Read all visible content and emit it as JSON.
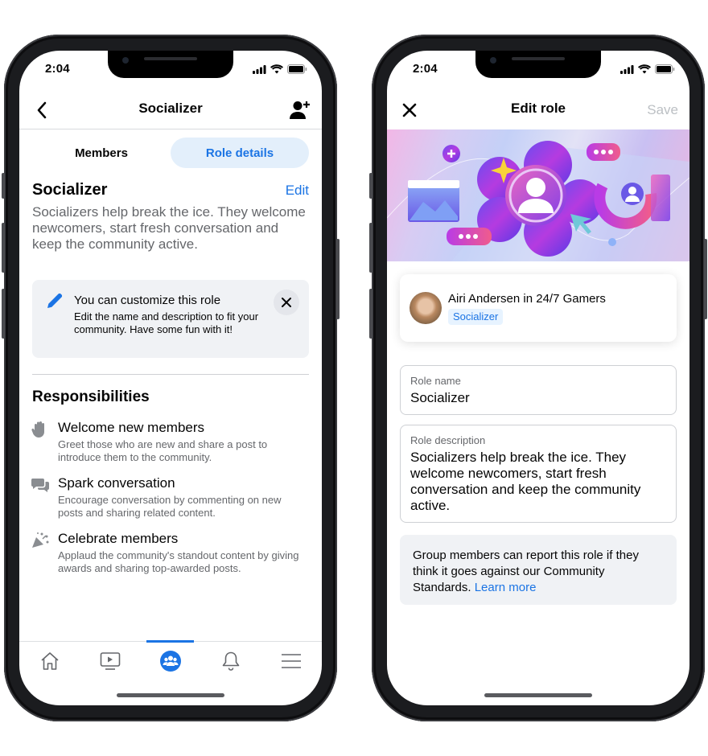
{
  "status_bar": {
    "time": "2:04"
  },
  "left_screen": {
    "nav": {
      "title": "Socializer",
      "back_icon": "chevron-left-icon",
      "action_icon": "add-person-icon"
    },
    "tabs": [
      {
        "label": "Members",
        "active": false
      },
      {
        "label": "Role details",
        "active": true
      }
    ],
    "role": {
      "title": "Socializer",
      "edit_label": "Edit",
      "description": "Socializers help break the ice. They welcome newcomers, start fresh conversation and keep the community active."
    },
    "tip": {
      "icon": "pencil-icon",
      "title": "You can customize this role",
      "body": "Edit the name and description to fit your community. Have some fun with it!",
      "close_icon": "close-icon"
    },
    "responsibilities": {
      "title": "Responsibilities",
      "items": [
        {
          "icon": "waving-hand-icon",
          "name": "Welcome new members",
          "description": "Greet those who are new and share a post to introduce them to the community."
        },
        {
          "icon": "chat-bubbles-icon",
          "name": "Spark conversation",
          "description": "Encourage conversation by commenting on new posts and sharing related content."
        },
        {
          "icon": "party-popper-icon",
          "name": "Celebrate members",
          "description": "Applaud the community's standout content by giving awards and sharing top-awarded posts."
        }
      ]
    },
    "tabbar": [
      {
        "icon": "home-icon",
        "active": false
      },
      {
        "icon": "video-icon",
        "active": false
      },
      {
        "icon": "groups-icon",
        "active": true
      },
      {
        "icon": "bell-icon",
        "active": false
      },
      {
        "icon": "menu-icon",
        "active": false
      }
    ]
  },
  "right_screen": {
    "nav": {
      "title": "Edit role",
      "close_icon": "close-icon",
      "save_label": "Save"
    },
    "profile": {
      "name_line": "Airi Andersen in 24/7 Gamers",
      "role_chip": "Socializer"
    },
    "fields": {
      "role_name": {
        "label": "Role name",
        "value": "Socializer"
      },
      "role_description": {
        "label": "Role description",
        "value": "Socializers help break the ice. They welcome newcomers, start fresh conversation and keep the community active."
      }
    },
    "notice": {
      "text": "Group members can report this role if they think it goes against our Community Standards. ",
      "link": "Learn more"
    }
  },
  "colors": {
    "accent": "#1b74e4",
    "secondary_text": "#65676b",
    "tip_bg": "#f0f2f5",
    "tab_active_bg": "#e3effb"
  }
}
